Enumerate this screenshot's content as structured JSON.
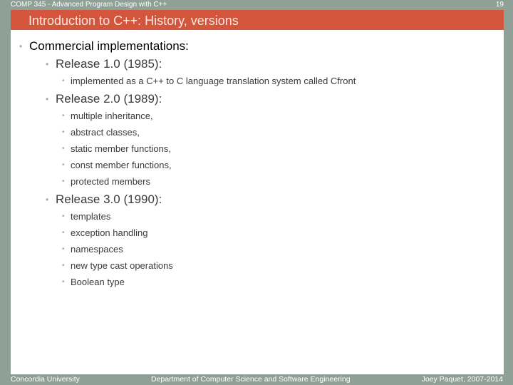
{
  "header": {
    "course": "COMP 345 - Advanced Program Design with C++",
    "page_number": "19"
  },
  "title": "Introduction to C++: History, versions",
  "content": {
    "heading": "Commercial implementations:",
    "releases": [
      {
        "label": "Release 1.0 (1985):",
        "items": [
          "implemented as a C++ to C language translation system called Cfront"
        ]
      },
      {
        "label": "Release 2.0 (1989):",
        "items": [
          "multiple inheritance,",
          "abstract classes,",
          "static member functions,",
          "const member functions,",
          "protected members"
        ]
      },
      {
        "label": "Release 3.0 (1990):",
        "items": [
          "templates",
          "exception handling",
          "namespaces",
          "new type cast operations",
          "Boolean type"
        ]
      }
    ]
  },
  "footer": {
    "left": "Concordia University",
    "center": "Department of Computer Science and Software Engineering",
    "right": "Joey Paquet, 2007-2014"
  }
}
